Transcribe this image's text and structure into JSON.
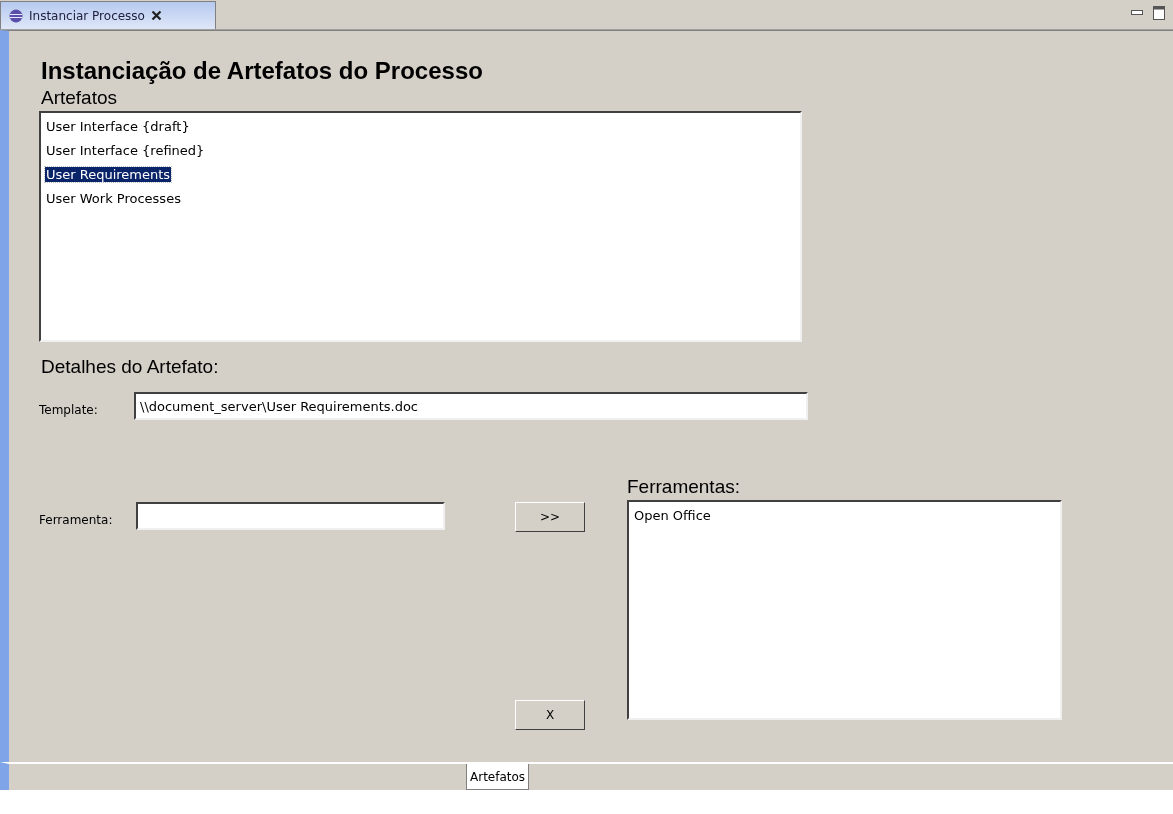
{
  "editor_tabs": [
    {
      "label": "Instanciar Processo",
      "selected": true,
      "closable": true
    }
  ],
  "heading": "Instanciação de Artefatos do Processo",
  "artifacts": {
    "label": "Artefatos",
    "items": [
      {
        "label": "User Interface {draft}",
        "selected": false
      },
      {
        "label": "User Interface {refined}",
        "selected": false
      },
      {
        "label": "User Requirements",
        "selected": true
      },
      {
        "label": "User Work Processes",
        "selected": false
      }
    ]
  },
  "details": {
    "label": "Detalhes do Artefato:",
    "template_label": "Template:",
    "template_value": "\\\\document_server\\User Requirements.doc"
  },
  "tool": {
    "label": "Ferramenta:",
    "add_button": ">>",
    "remove_button": "X"
  },
  "tools_list": {
    "label": "Ferramentas:",
    "items": [
      {
        "label": "Open Office",
        "selected": false
      }
    ]
  },
  "bottom_tabs": [
    {
      "label": "Artefatos",
      "selected": true
    }
  ]
}
